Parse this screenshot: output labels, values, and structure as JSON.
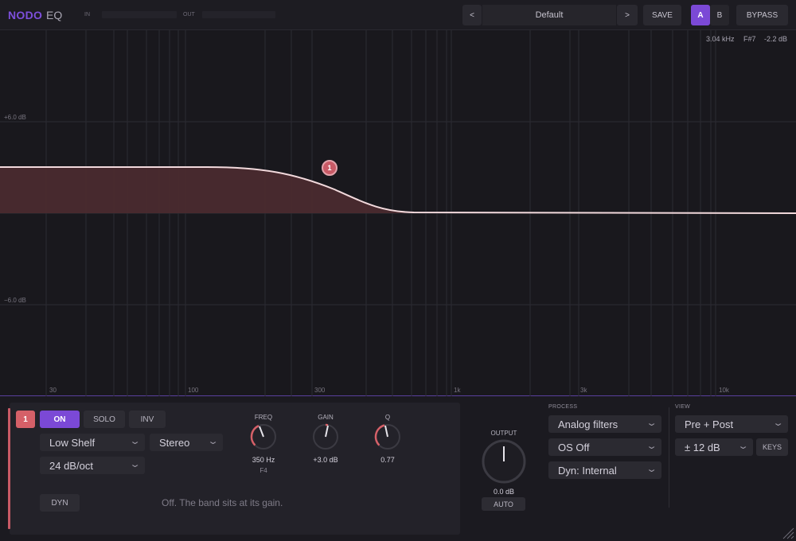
{
  "app": {
    "brand": "NODO",
    "brand_sub": "EQ"
  },
  "meters": {
    "in_label": "IN",
    "out_label": "OUT"
  },
  "preset": {
    "prev": "<",
    "name": "Default",
    "next": ">",
    "save": "SAVE"
  },
  "ab": {
    "a": "A",
    "b": "B"
  },
  "bypass": "BYPASS",
  "readout": {
    "freq": "3.04 kHz",
    "note": "F#7",
    "gain": "-2.2 dB"
  },
  "graph": {
    "db_labels": [
      "+6.0 dB",
      "−6.0 dB"
    ],
    "freq_labels": [
      "30",
      "100",
      "300",
      "1k",
      "3k",
      "10k"
    ],
    "node_label": "1",
    "curve_color": "#f2d9dc",
    "fill_color": "#4a2a2f"
  },
  "band": {
    "number": "1",
    "on": "ON",
    "solo": "SOLO",
    "inv": "INV",
    "type": "Low Shelf",
    "channel": "Stereo",
    "slope": "24 dB/oct",
    "dyn": "DYN",
    "dyn_text": "Off. The band sits at its gain.",
    "freq": {
      "label": "FREQ",
      "value": "350 Hz",
      "note": "F4"
    },
    "gain": {
      "label": "GAIN",
      "value": "+3.0 dB"
    },
    "q": {
      "label": "Q",
      "value": "0.77"
    },
    "accent_color": "#c85a66"
  },
  "output": {
    "label": "OUTPUT",
    "value": "0.0 dB",
    "auto": "AUTO"
  },
  "process": {
    "label": "PROCESS",
    "filters": "Analog filters",
    "os": "OS Off",
    "dyn": "Dyn: Internal"
  },
  "view": {
    "label": "VIEW",
    "mode": "Pre + Post",
    "range": "± 12 dB",
    "keys": "KEYS"
  },
  "colors": {
    "accent": "#7b49d6",
    "band": "#c85a66"
  }
}
